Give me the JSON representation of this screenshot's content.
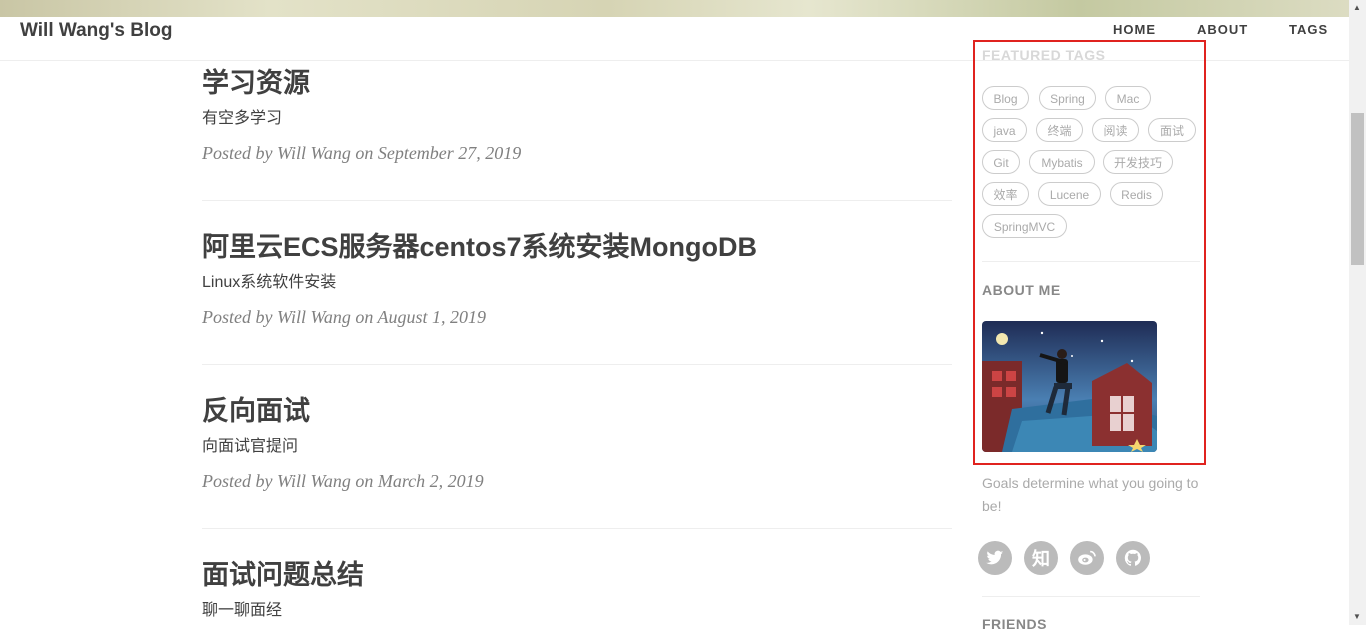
{
  "brand": "Will Wang's Blog",
  "nav": {
    "home": "HOME",
    "about": "ABOUT",
    "tags": "TAGS"
  },
  "posts": [
    {
      "title": "学习资源",
      "subtitle": "有空多学习",
      "meta": "Posted by Will Wang on September 27, 2019"
    },
    {
      "title": "阿里云ECS服务器centos7系统安装MongoDB",
      "subtitle": "Linux系统软件安装",
      "meta": "Posted by Will Wang on August 1, 2019"
    },
    {
      "title": "反向面试",
      "subtitle": "向面试官提问",
      "meta": "Posted by Will Wang on March 2, 2019"
    },
    {
      "title": "面试问题总结",
      "subtitle": "聊一聊面经",
      "meta": ""
    }
  ],
  "sidebar": {
    "featured_tags_heading": "FEATURED TAGS",
    "tags": [
      "Blog",
      "Spring",
      "Mac",
      "java",
      "终端",
      "阅读",
      "面试",
      "Git",
      "Mybatis",
      "开发技巧",
      "效率",
      "Lucene",
      "Redis",
      "SpringMVC"
    ],
    "about_heading": "ABOUT ME",
    "goals": "Goals determine what you going to be!",
    "friends_heading": "FRIENDS",
    "social": [
      {
        "icon": "twitter-icon",
        "glyph": "🐦"
      },
      {
        "icon": "zhihu-icon",
        "glyph": "知"
      },
      {
        "icon": "weibo-icon",
        "glyph": "微"
      },
      {
        "icon": "github-icon",
        "glyph": "●"
      }
    ]
  },
  "colors": {
    "accent_highlight": "#e0231f",
    "text": "#404040",
    "muted": "#808080"
  }
}
